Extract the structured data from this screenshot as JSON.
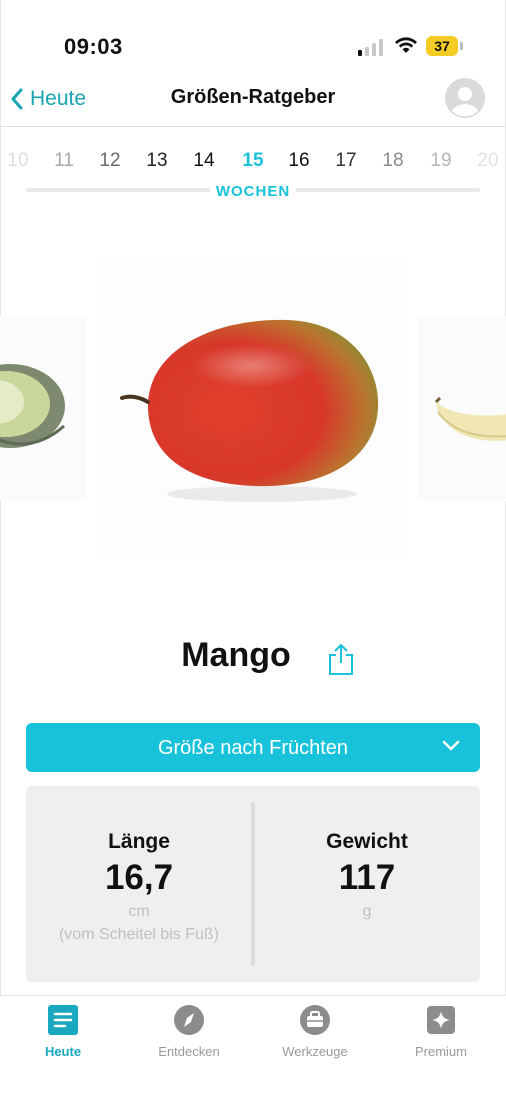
{
  "status": {
    "time": "09:03",
    "battery": "37"
  },
  "nav": {
    "back_label": "Heute",
    "title": "Größen-Ratgeber"
  },
  "weeks": {
    "items": [
      "10",
      "11",
      "12",
      "13",
      "14",
      "15",
      "16",
      "17",
      "18",
      "19",
      "20"
    ],
    "selected": "15",
    "label": "WOCHEN"
  },
  "fruit": {
    "name": "Mango"
  },
  "dropdown": {
    "label": "Größe nach Früchten"
  },
  "stats": {
    "length": {
      "title": "Länge",
      "value": "16,7",
      "unit": "cm",
      "note": "(vom Scheitel bis Fuß)"
    },
    "weight": {
      "title": "Gewicht",
      "value": "117",
      "unit": "g"
    }
  },
  "tabs": [
    {
      "label": "Heute",
      "icon": "today-icon",
      "active": true
    },
    {
      "label": "Entdecken",
      "icon": "compass-icon",
      "active": false
    },
    {
      "label": "Werkzeuge",
      "icon": "toolbox-icon",
      "active": false
    },
    {
      "label": "Premium",
      "icon": "sparkle-icon",
      "active": false
    }
  ],
  "colors": {
    "accent": "#19c2db",
    "link": "#17a5b3",
    "active_tab": "#1aa8c0"
  }
}
